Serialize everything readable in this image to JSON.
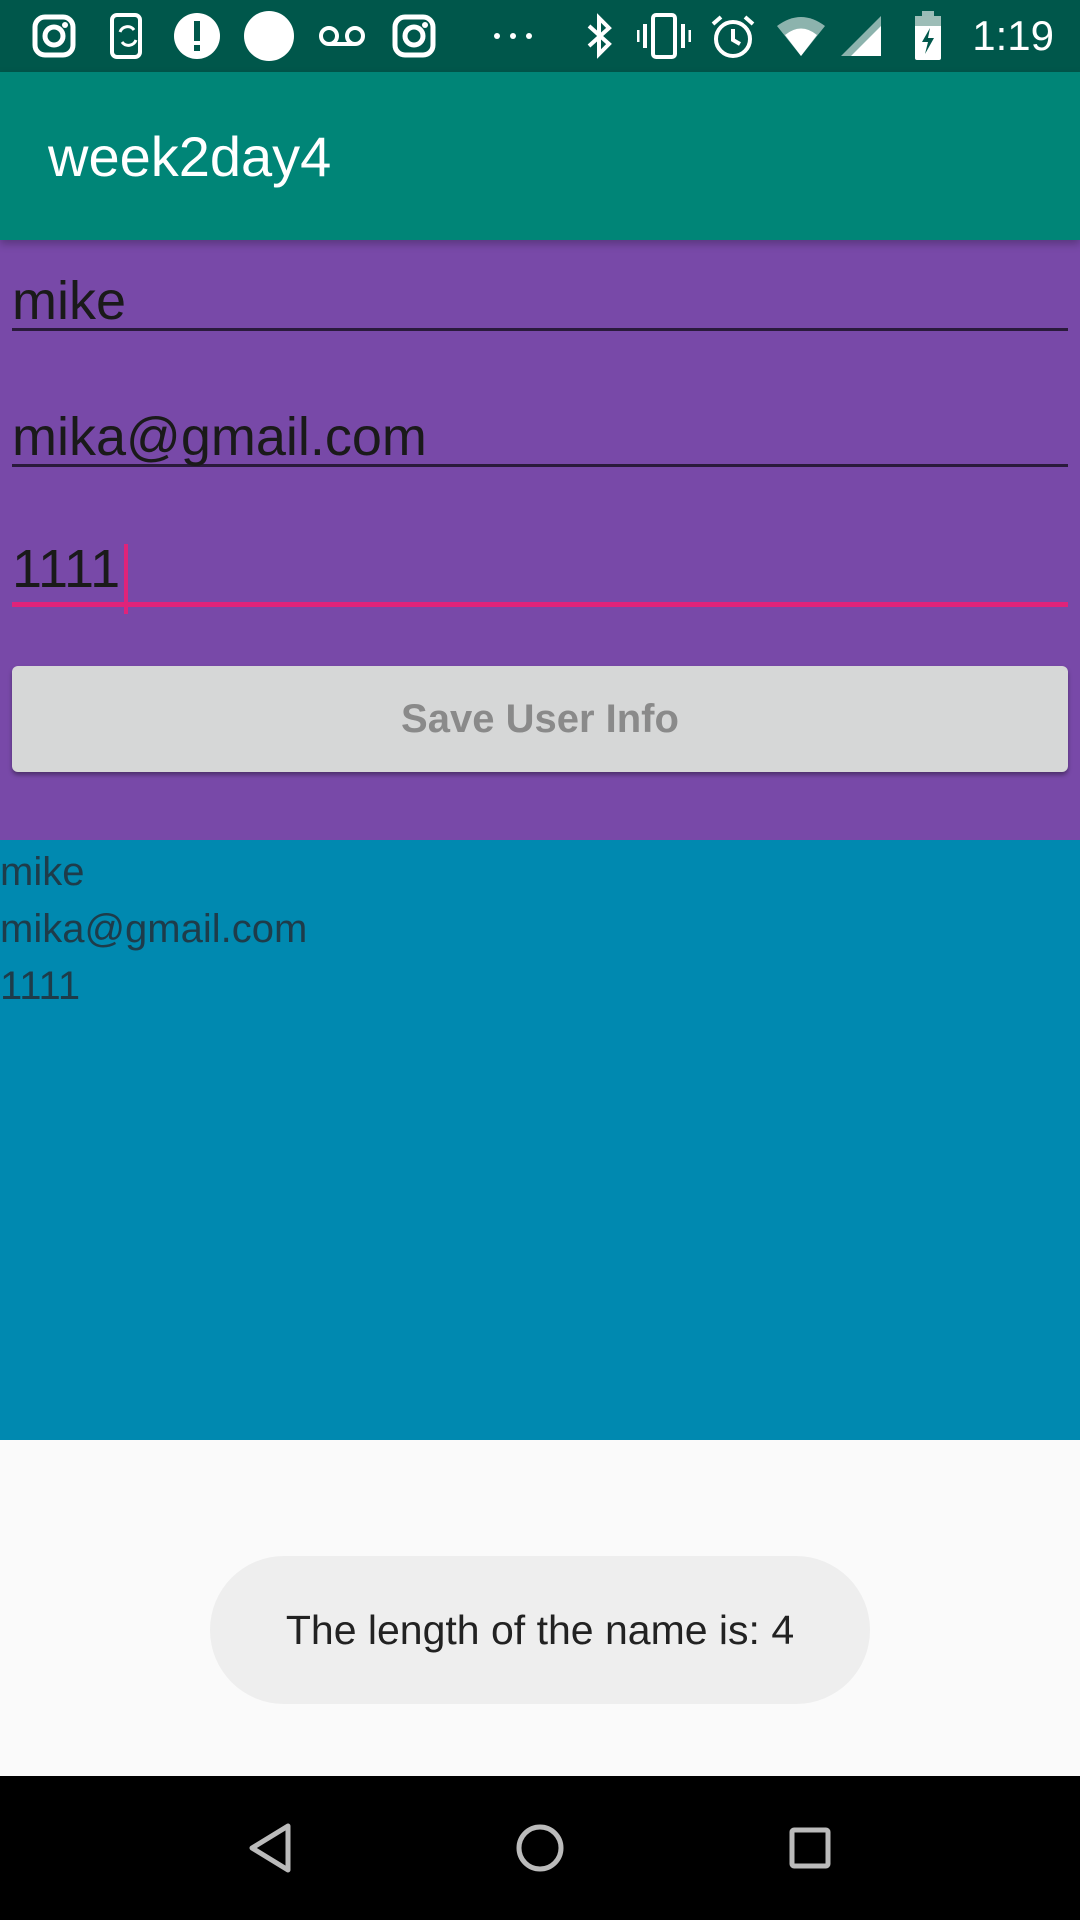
{
  "status_bar": {
    "time": "1:19",
    "left_icons": [
      "instagram-icon",
      "phone-sync-icon",
      "alert-icon",
      "circle-icon",
      "voicemail-icon",
      "instagram-icon",
      "more-icon"
    ],
    "right_icons": [
      "bluetooth-icon",
      "vibrate-icon",
      "alarm-icon",
      "wifi-icon",
      "signal-icon",
      "battery-charging-icon"
    ]
  },
  "app_bar": {
    "title": "week2day4"
  },
  "form": {
    "name_value": "mike",
    "email_value": "mika@gmail.com",
    "password_value": "1111",
    "save_label": "Save User Info"
  },
  "output": {
    "lines": [
      "mike",
      "mika@gmail.com",
      "1111"
    ]
  },
  "toast": {
    "message": "The length of the name is: 4"
  },
  "nav_bar": {
    "buttons": [
      "back-icon",
      "home-icon",
      "recents-icon"
    ]
  },
  "colors": {
    "status_bar": "#00574b",
    "app_bar": "#008577",
    "form_background": "#7849a8",
    "output_background": "#0089b0",
    "accent": "#e0237a",
    "button": "#d6d7d7"
  }
}
